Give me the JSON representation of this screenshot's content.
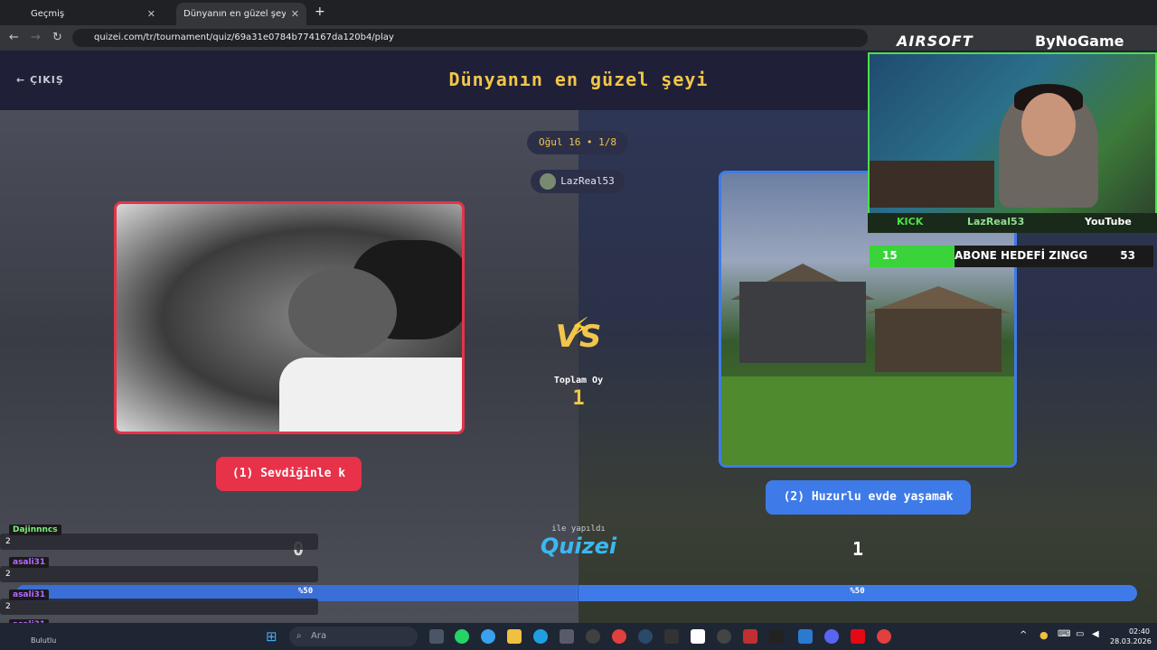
{
  "browser": {
    "tabs": [
      {
        "label": "Geçmiş",
        "active": false
      },
      {
        "label": "Dünyanın en güzel şeyi - Tier Li",
        "active": true
      }
    ],
    "new_tab": "+",
    "url": "quizei.com/tr/tournament/quiz/69a31e0784b774167da120b4/play"
  },
  "app": {
    "exit_label": "ÇIKIŞ",
    "title": "Dünyanın en güzel şeyi",
    "round_label": "Oğul 16 • 1/8",
    "creator_name": "LazReal53",
    "vs_label": "VS",
    "total_votes_label": "Toplam Oy",
    "total_votes_value": "1",
    "made_with_label": "ile yapıldı",
    "logo_label": "Quizei",
    "choices": [
      {
        "label": "(1) Sevdiğinle k",
        "score": "0",
        "percent": "%50",
        "border_color": "#e8324a"
      },
      {
        "label": "(2) Huzurlu evde yaşamak",
        "score": "1",
        "percent": "%50",
        "border_color": "#3f7be8"
      }
    ],
    "bar_split": 0.5
  },
  "chat": {
    "messages": [
      {
        "user": "Dajinnncs",
        "count": "2",
        "color": "#7af07a"
      },
      {
        "user": "asali31",
        "count": "2",
        "color": "#b46aff"
      },
      {
        "user": "asali31",
        "count": "2",
        "color": "#b46aff"
      },
      {
        "user": "asali31",
        "count": "",
        "color": "#b46aff"
      }
    ]
  },
  "stream": {
    "sponsor1": "AIRSOFT",
    "sponsor2": "ByNoGame",
    "platform_left": "KICK",
    "channel_name": "LazReal53",
    "platform_right": "YouTube",
    "sub_goal_label": "ABONE HEDEFİ ZINGG",
    "sub_goal_current": "15",
    "sub_goal_target": "53",
    "sub_goal_progress": 0.3
  },
  "taskbar": {
    "weather": "Bulutlu",
    "search_placeholder": "Ara",
    "time": "02:40",
    "date": "28.03.2026"
  }
}
